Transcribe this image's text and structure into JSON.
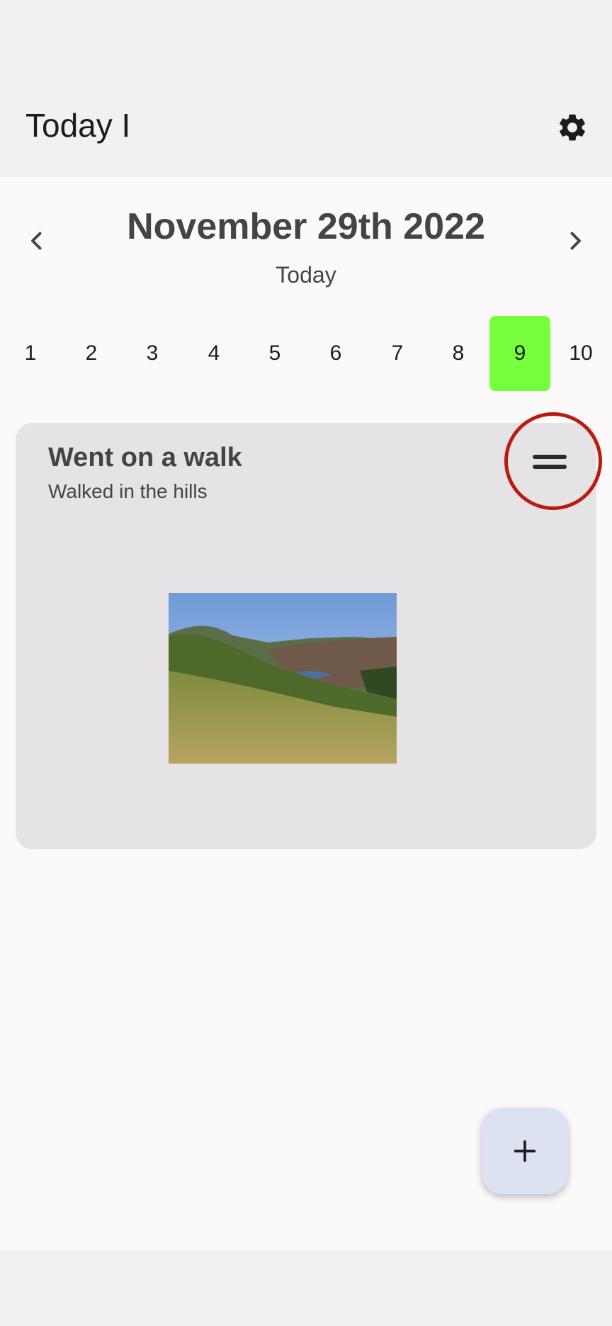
{
  "app_bar": {
    "title": "Today I",
    "settings_icon": "gear-icon"
  },
  "date_nav": {
    "date": "November 29th 2022",
    "relative": "Today",
    "prev_icon": "chevron-left-icon",
    "next_icon": "chevron-right-icon"
  },
  "days": {
    "items": [
      "1",
      "2",
      "3",
      "4",
      "5",
      "6",
      "7",
      "8",
      "9",
      "10"
    ],
    "selected": "9",
    "selected_color": "#77ff3d"
  },
  "entry": {
    "title": "Went on a walk",
    "description": "Walked in the hills",
    "handle_icon": "drag-handle-icon"
  },
  "fab": {
    "icon": "plus-icon"
  },
  "colors": {
    "highlight": "#bb1a10",
    "card": "#e5e3e5",
    "fab": "#dce2f1"
  }
}
